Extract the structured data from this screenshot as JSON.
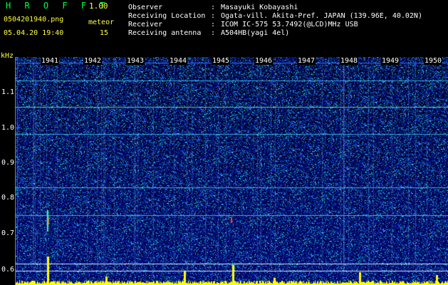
{
  "app": {
    "brand": "H R O F F T",
    "version": "1.00"
  },
  "file": {
    "name": "0504201940.png",
    "datetime": "05.04.20 19:40"
  },
  "meteor": {
    "label": "meteor",
    "count": "15"
  },
  "info": [
    {
      "label": "Observer",
      "value": "Masayuki Kobayashi"
    },
    {
      "label": "Receiving Location",
      "value": "Ogata-vill. Akita-Pref. JAPAN (139.96E, 40.02N)"
    },
    {
      "label": "Receiver",
      "value": "ICOM IC-575 53.7492(@LCD)MHz USB"
    },
    {
      "label": "Receiving antenna",
      "value": "A504HB(yagi 4el)"
    }
  ],
  "axis": {
    "unit": "kHz",
    "freq_ticks": [
      "1.1",
      "1.0",
      "0.9",
      "0.8",
      "0.7",
      "0.6"
    ],
    "time_ticks": [
      "1941",
      "1942",
      "1943",
      "1944",
      "1945",
      "1946",
      "1947",
      "1948",
      "1949",
      "1950"
    ]
  },
  "colors": {
    "brand": "#00ff40",
    "accent": "#ffff40",
    "text": "#ffffff",
    "background": "#000000"
  }
}
